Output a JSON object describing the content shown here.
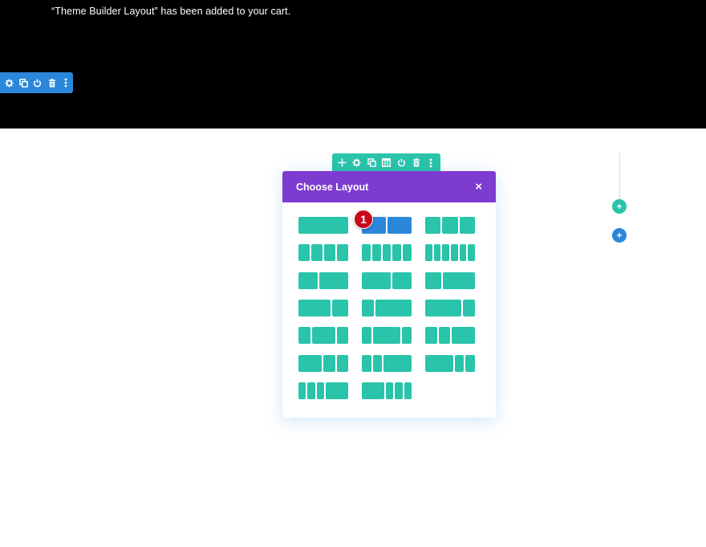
{
  "notice": {
    "text": "“Theme Builder Layout” has been added to your cart."
  },
  "section_toolbar": {
    "color": "#2b87da",
    "icons": [
      "gear-icon",
      "duplicate-icon",
      "power-icon",
      "trash-icon",
      "more-icon"
    ]
  },
  "row_toolbar": {
    "color": "#29c4a9",
    "icons": [
      "move-icon",
      "gear-icon",
      "duplicate-icon",
      "columns-icon",
      "power-icon",
      "trash-icon",
      "more-icon"
    ]
  },
  "modal": {
    "title": "Choose Layout",
    "close_label": "×",
    "header_color": "#7e3bd0",
    "selected_index": 1,
    "column_color": "#29c4a9",
    "selected_color": "#2b87da",
    "layouts": [
      {
        "name": "1",
        "cols": [
          1
        ]
      },
      {
        "name": "1/2+1/2",
        "cols": [
          1,
          1
        ]
      },
      {
        "name": "1/3+1/3+1/3",
        "cols": [
          1,
          1,
          1
        ]
      },
      {
        "name": "1/4x4",
        "cols": [
          1,
          1,
          1,
          1
        ]
      },
      {
        "name": "1/5x5",
        "cols": [
          1,
          1,
          1,
          1,
          1
        ]
      },
      {
        "name": "1/6x6",
        "cols": [
          1,
          1,
          1,
          1,
          1,
          1
        ]
      },
      {
        "name": "2/5+3/5",
        "cols": [
          2,
          3
        ]
      },
      {
        "name": "3/5+2/5",
        "cols": [
          3,
          2
        ]
      },
      {
        "name": "1/3+2/3",
        "cols": [
          1,
          2
        ]
      },
      {
        "name": "2/3+1/3",
        "cols": [
          2,
          1
        ]
      },
      {
        "name": "1/4+3/4",
        "cols": [
          1,
          3
        ]
      },
      {
        "name": "3/4+1/4",
        "cols": [
          3,
          1
        ]
      },
      {
        "name": "1/4+1/2+1/4",
        "cols": [
          1,
          2,
          1
        ]
      },
      {
        "name": "1/5+3/5+1/5",
        "cols": [
          1,
          3,
          1
        ]
      },
      {
        "name": "1/4+1/4+1/2",
        "cols": [
          1,
          1,
          2
        ]
      },
      {
        "name": "1/2+1/4+1/4",
        "cols": [
          2,
          1,
          1
        ]
      },
      {
        "name": "1/5+1/5+3/5",
        "cols": [
          1,
          1,
          3
        ]
      },
      {
        "name": "3/5+1/5+1/5",
        "cols": [
          3,
          1,
          1
        ]
      },
      {
        "name": "1/6+1/6+1/6+1/2",
        "cols": [
          1,
          1,
          1,
          3
        ]
      },
      {
        "name": "1/2+1/6+1/6+1/6",
        "cols": [
          3,
          1,
          1,
          1
        ]
      }
    ]
  },
  "callout": {
    "number": "1",
    "color": "#c5091b"
  },
  "add_row_button": {
    "label": "+",
    "color": "#29c4a9"
  },
  "add_section_button": {
    "label": "+",
    "color": "#2b87da"
  }
}
